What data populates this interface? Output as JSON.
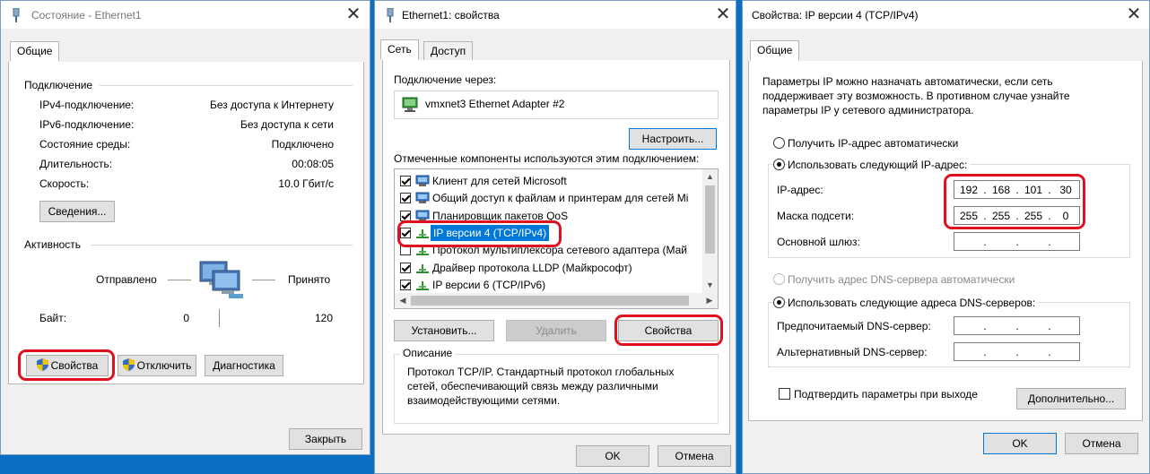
{
  "status_window": {
    "title": "Состояние - Ethernet1",
    "tab_general": "Общие",
    "section_connection": "Подключение",
    "rows": [
      {
        "label": "IPv4-подключение:",
        "value": "Без доступа к Интернету"
      },
      {
        "label": "IPv6-подключение:",
        "value": "Без доступа к сети"
      },
      {
        "label": "Состояние среды:",
        "value": "Подключено"
      },
      {
        "label": "Длительность:",
        "value": "00:08:05"
      },
      {
        "label": "Скорость:",
        "value": "10.0 Гбит/с"
      }
    ],
    "details_button": "Сведения...",
    "section_activity": "Активность",
    "sent_label": "Отправлено",
    "received_label": "Принято",
    "bytes_label": "Байт:",
    "bytes_sent": "0",
    "bytes_received": "120",
    "properties_button": "Свойства",
    "disable_button": "Отключить",
    "diagnose_button": "Диагностика",
    "close_button": "Закрыть"
  },
  "props_window": {
    "title": "Ethernet1: свойства",
    "tab_network": "Сеть",
    "tab_sharing": "Доступ",
    "connect_using_label": "Подключение через:",
    "adapter_name": "vmxnet3 Ethernet Adapter #2",
    "configure_button": "Настроить...",
    "components_label": "Отмеченные компоненты используются этим подключением:",
    "components": [
      {
        "label": "Клиент для сетей Microsoft",
        "checked": true,
        "icon": "network-client-icon",
        "selected": false
      },
      {
        "label": "Общий доступ к файлам и принтерам для сетей Mi",
        "checked": true,
        "icon": "network-service-icon",
        "selected": false
      },
      {
        "label": "Планировщик пакетов QoS",
        "checked": true,
        "icon": "network-service-icon",
        "selected": false
      },
      {
        "label": "IP версии 4 (TCP/IPv4)",
        "checked": true,
        "icon": "protocol-icon",
        "selected": true
      },
      {
        "label": "Протокол мультиплексора сетевого адаптера (Май",
        "checked": false,
        "icon": "protocol-icon",
        "selected": false
      },
      {
        "label": "Драйвер протокола LLDP (Майкрософт)",
        "checked": true,
        "icon": "protocol-icon",
        "selected": false
      },
      {
        "label": "IP версии 6 (TCP/IPv6)",
        "checked": true,
        "icon": "protocol-icon",
        "selected": false
      }
    ],
    "install_button": "Установить...",
    "uninstall_button": "Удалить",
    "properties_button": "Свойства",
    "description_label": "Описание",
    "description_text": "Протокол TCP/IP. Стандартный протокол глобальных сетей, обеспечивающий связь между различными взаимодействующими сетями.",
    "ok_button": "OK",
    "cancel_button": "Отмена"
  },
  "ipv4_window": {
    "title": "Свойства: IP версии 4 (TCP/IPv4)",
    "tab_general": "Общие",
    "intro_text": "Параметры IP можно назначать автоматически, если сеть поддерживает эту возможность. В противном случае узнайте параметры IP у сетевого администратора.",
    "radio_auto_ip": "Получить IP-адрес автоматически",
    "radio_manual_ip": "Использовать следующий IP-адрес:",
    "ip_label": "IP-адрес:",
    "ip_value": [
      "192",
      "168",
      "101",
      "30"
    ],
    "mask_label": "Маска подсети:",
    "mask_value": [
      "255",
      "255",
      "255",
      "0"
    ],
    "gateway_label": "Основной шлюз:",
    "radio_auto_dns": "Получить адрес DNS-сервера автоматически",
    "radio_manual_dns": "Использовать следующие адреса DNS-серверов:",
    "preferred_dns_label": "Предпочитаемый DNS-сервер:",
    "alternate_dns_label": "Альтернативный DNS-сервер:",
    "validate_checkbox": "Подтвердить параметры при выходе",
    "advanced_button": "Дополнительно...",
    "ok_button": "OK",
    "cancel_button": "Отмена"
  },
  "colors": {
    "highlight": "#e0101e",
    "selection": "#0078d7",
    "desktop": "#0a6fc2"
  }
}
